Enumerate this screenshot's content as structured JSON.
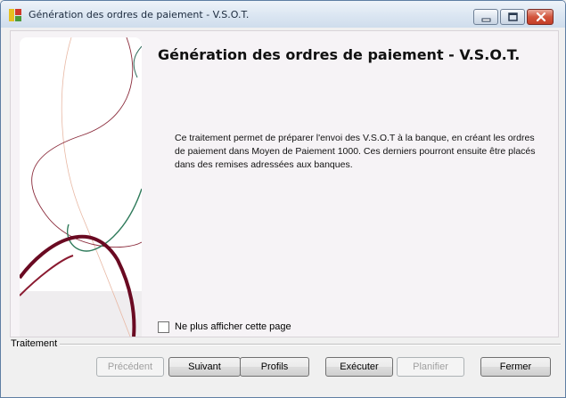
{
  "window": {
    "title": "Génération des ordres de paiement - V.S.O.T."
  },
  "page": {
    "heading": "Génération des ordres de paiement - V.S.O.T.",
    "description": "Ce traitement permet de préparer l'envoi des V.S.O.T à la banque, en créant les ordres de paiement dans Moyen de Paiement 1000. Ces derniers pourront ensuite être placés dans des remises adressées aux banques.",
    "checkbox_label": "Ne plus afficher cette page",
    "checkbox_checked": false
  },
  "group": {
    "label": "Traitement"
  },
  "buttons": {
    "precedent": "Précédent",
    "suivant": "Suivant",
    "profils": "Profils",
    "executer": "Exécuter",
    "planifier": "Planifier",
    "fermer": "Fermer"
  },
  "icons": {
    "app": "app-icon",
    "minimize": "minimize-icon",
    "maximize": "maximize-icon",
    "close": "close-icon"
  }
}
